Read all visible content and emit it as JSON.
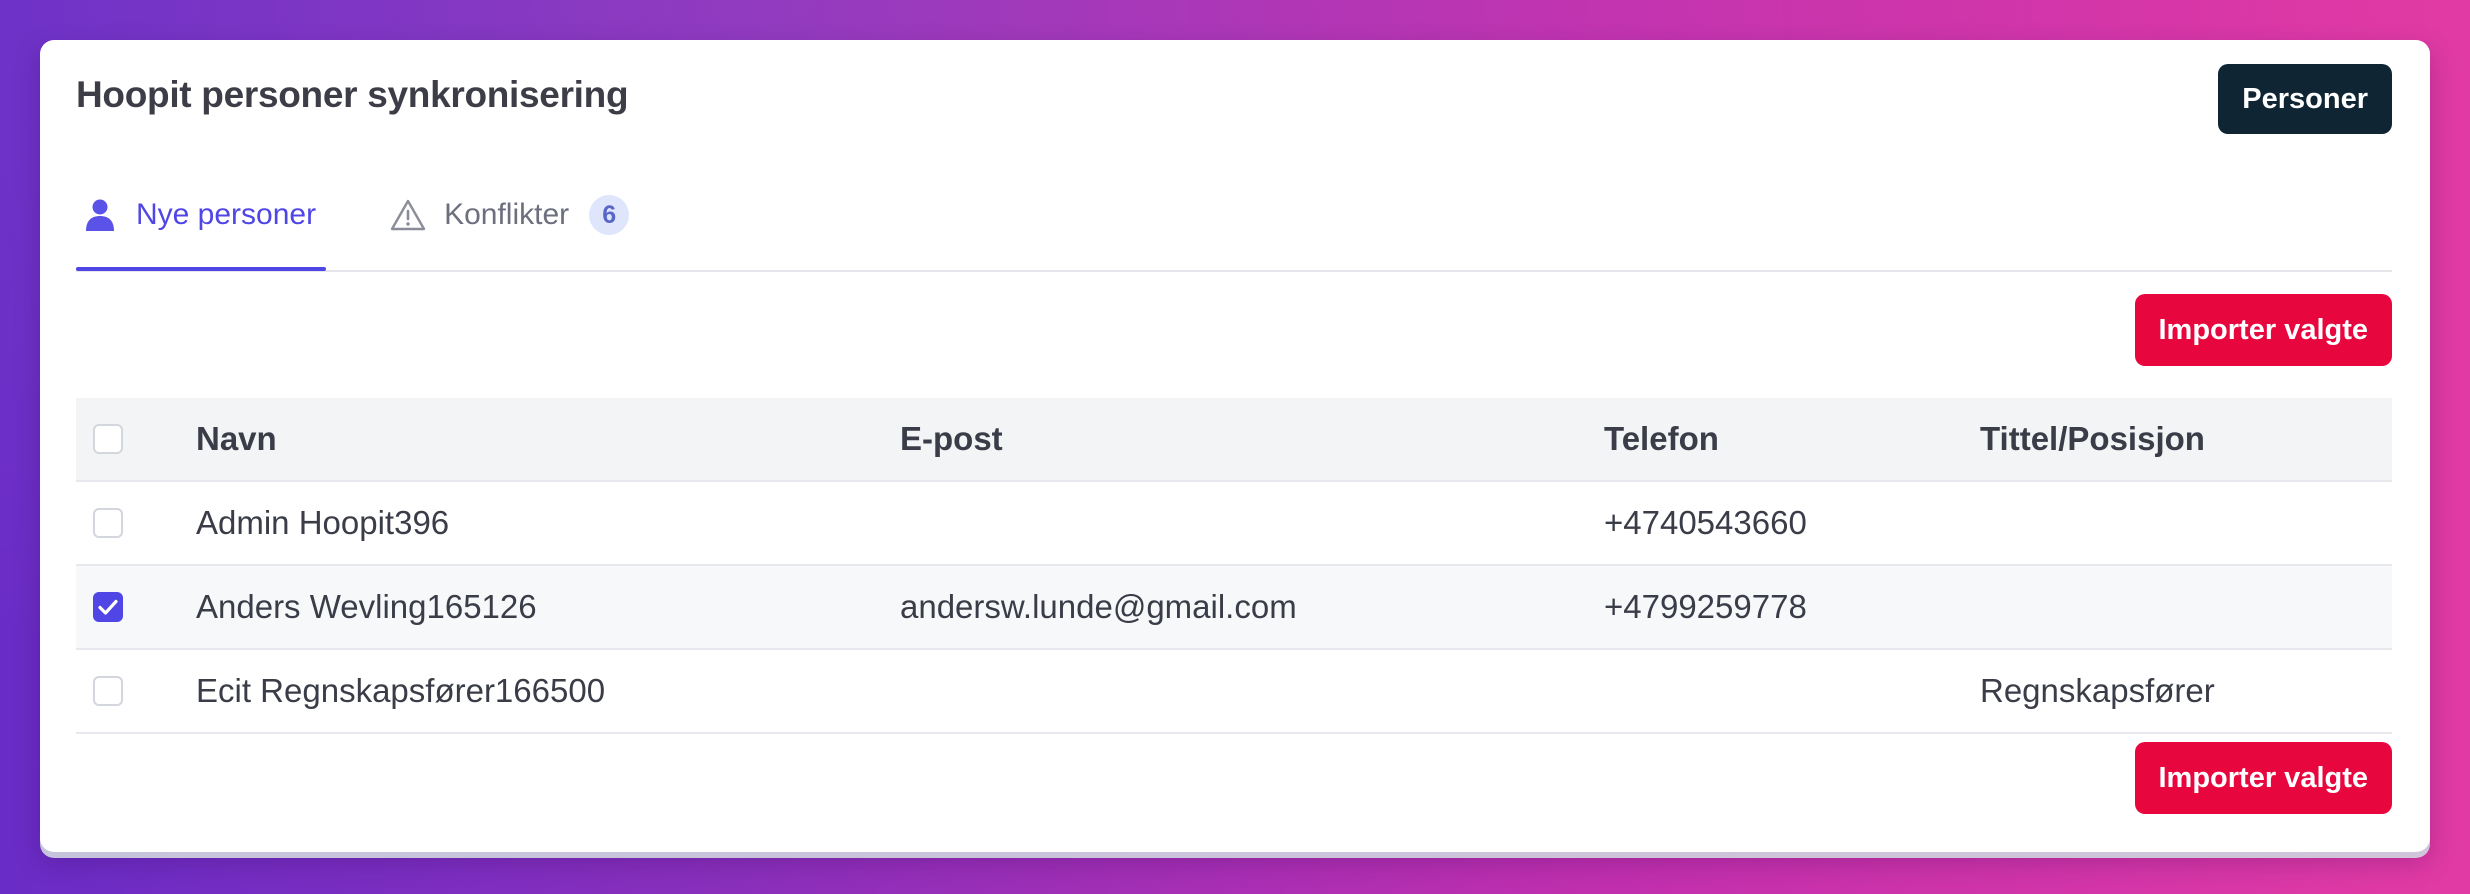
{
  "header": {
    "title": "Hoopit personer synkronisering",
    "persons_button_label": "Personer"
  },
  "tabs": [
    {
      "label": "Nye personer",
      "icon": "person-icon",
      "active": true
    },
    {
      "label": "Konflikter",
      "icon": "warning-icon",
      "badge": "6",
      "active": false
    }
  ],
  "actions": {
    "import_label": "Importer valgte"
  },
  "table": {
    "columns": [
      "Navn",
      "E-post",
      "Telefon",
      "Tittel/Posisjon"
    ],
    "rows": [
      {
        "selected": false,
        "name": "Admin Hoopit396",
        "email": "",
        "phone": "+4740543660",
        "title": ""
      },
      {
        "selected": true,
        "name": "Anders Wevling165126",
        "email": "andersw.lunde@gmail.com",
        "phone": "+4799259778",
        "title": ""
      },
      {
        "selected": false,
        "name": "Ecit Regnskapsfører166500",
        "email": "",
        "phone": "",
        "title": "Regnskapsfører"
      }
    ]
  },
  "colors": {
    "accent": "#4f46e5",
    "primary_action": "#e8063f",
    "dark_button": "#0f2534",
    "badge_bg": "#dfe6fb"
  }
}
